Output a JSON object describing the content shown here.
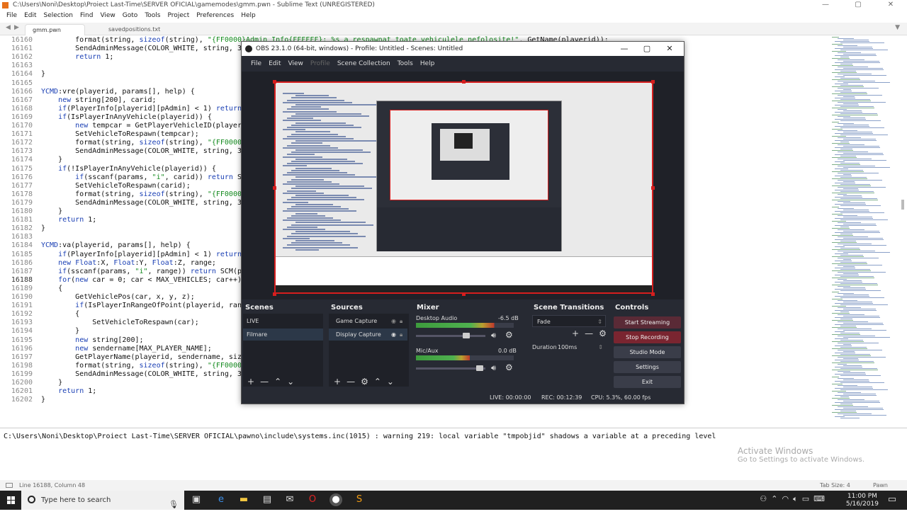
{
  "sublime": {
    "title": "C:\\Users\\Noni\\Desktop\\Proiect Last-Time\\SERVER OFICIAL\\gamemodes\\gmm.pwn - Sublime Text (UNREGISTERED)",
    "menu": [
      "File",
      "Edit",
      "Selection",
      "Find",
      "View",
      "Goto",
      "Tools",
      "Project",
      "Preferences",
      "Help"
    ],
    "tabs": [
      "gmm.pwn",
      "savedpositions.txt"
    ],
    "lines": [
      {
        "n": "16160",
        "t": "        format(string, sizeof(string), \"{FF0000}Admin Info{FFFFFF}: %s a respawnat toate vehiculele nefolosite!\", GetName(playerid));"
      },
      {
        "n": "16161",
        "t": "        SendAdminMessage(COLOR_WHITE, string, 3);"
      },
      {
        "n": "16162",
        "t": "        return 1;"
      },
      {
        "n": "16163",
        "t": "    "
      },
      {
        "n": "16164",
        "t": "}"
      },
      {
        "n": "16165",
        "t": ""
      },
      {
        "n": "16166",
        "t": "YCMD:vre(playerid, params[], help) {"
      },
      {
        "n": "16167",
        "t": "    new string[200], carid;"
      },
      {
        "n": "16168",
        "t": "    if(PlayerInfo[playerid][pAdmin] < 1) return"
      },
      {
        "n": "16169",
        "t": "    if(IsPlayerInAnyVehicle(playerid)) {"
      },
      {
        "n": "16170",
        "t": "        new tempcar = GetPlayerVehicleID(playeri"
      },
      {
        "n": "16171",
        "t": "        SetVehicleToRespawn(tempcar);"
      },
      {
        "n": "16172",
        "t": "        format(string, sizeof(string), \"{FF0000"
      },
      {
        "n": "16173",
        "t": "        SendAdminMessage(COLOR_WHITE, string, 3)"
      },
      {
        "n": "16174",
        "t": "    }"
      },
      {
        "n": "16175",
        "t": "    if(!IsPlayerInAnyVehicle(playerid)) {"
      },
      {
        "n": "16176",
        "t": "        if(sscanf(params, \"i\", carid)) return SC"
      },
      {
        "n": "16177",
        "t": "        SetVehicleToRespawn(carid);"
      },
      {
        "n": "16178",
        "t": "        format(string, sizeof(string), \"{FF0000"
      },
      {
        "n": "16179",
        "t": "        SendAdminMessage(COLOR_WHITE, string, 3)"
      },
      {
        "n": "16180",
        "t": "    }"
      },
      {
        "n": "16181",
        "t": "    return 1;"
      },
      {
        "n": "16182",
        "t": "}"
      },
      {
        "n": "16183",
        "t": ""
      },
      {
        "n": "16184",
        "t": "YCMD:va(playerid, params[], help) {"
      },
      {
        "n": "16185",
        "t": "    if(PlayerInfo[playerid][pAdmin] < 1) return"
      },
      {
        "n": "16186",
        "t": "    new Float:X, Float:Y, Float:Z, range;"
      },
      {
        "n": "16187",
        "t": "    if(sscanf(params, \"i\", range)) return SCM(pl"
      },
      {
        "n": "16188",
        "t": "    for(new car = 0; car < MAX_VEHICLES; car++)"
      },
      {
        "n": "16189",
        "t": "    {"
      },
      {
        "n": "16190",
        "t": "        GetVehiclePos(car, x, y, z);"
      },
      {
        "n": "16191",
        "t": "        if(IsPlayerInRangeOfPoint(playerid, rang"
      },
      {
        "n": "16192",
        "t": "        {"
      },
      {
        "n": "16193",
        "t": "            SetVehicleToRespawn(car);"
      },
      {
        "n": "16194",
        "t": "        }"
      },
      {
        "n": "16195",
        "t": "        new string[200];"
      },
      {
        "n": "16196",
        "t": "        new sendername[MAX_PLAYER_NAME];"
      },
      {
        "n": "16197",
        "t": "        GetPlayerName(playerid, sendername, size"
      },
      {
        "n": "16198",
        "t": "        format(string, sizeof(string), \"{FF0000"
      },
      {
        "n": "16199",
        "t": "        SendAdminMessage(COLOR_WHITE, string, 3)"
      },
      {
        "n": "16200",
        "t": "    }"
      },
      {
        "n": "16201",
        "t": "    return 1;"
      },
      {
        "n": "16202",
        "t": "}"
      }
    ],
    "console": "C:\\Users\\Noni\\Desktop\\Proiect Last-Time\\SERVER OFICIAL\\pawno\\include\\systems.inc(1015) : warning 219: local variable \"tmpobjid\" shadows a variable at a preceding level",
    "status_left": "Line 16188, Column 48",
    "status_tab": "Tab Size: 4",
    "status_syntax": "Pawn"
  },
  "activate": {
    "title": "Activate Windows",
    "sub": "Go to Settings to activate Windows."
  },
  "obs": {
    "title": "OBS 23.1.0 (64-bit, windows) - Profile: Untitled - Scenes: Untitled",
    "menu": [
      "File",
      "Edit",
      "View",
      "Profile",
      "Scene Collection",
      "Tools",
      "Help"
    ],
    "docks": {
      "scenes": "Scenes",
      "sources": "Sources",
      "mixer": "Mixer",
      "transitions": "Scene Transitions",
      "controls": "Controls"
    },
    "scenes": [
      "LIVE",
      "Filmare"
    ],
    "sources": [
      "Game Capture",
      "Display Capture"
    ],
    "mixer": [
      {
        "name": "Desktop Audio",
        "db": "-6.5 dB",
        "fill": 0.8,
        "vol": 0.75
      },
      {
        "name": "Mic/Aux",
        "db": "0.0 dB",
        "fill": 0.55,
        "vol": 0.97
      }
    ],
    "transition": "Fade",
    "duration_label": "Duration",
    "duration": "100ms",
    "controls": [
      "Start Streaming",
      "Stop Recording",
      "Studio Mode",
      "Settings",
      "Exit"
    ],
    "status": {
      "live": "LIVE: 00:00:00",
      "rec": "REC: 00:12:39",
      "cpu": "CPU: 5.3%, 60.00 fps"
    }
  },
  "taskbar": {
    "search_placeholder": "Type here to search",
    "time": "11:00 PM",
    "date": "5/16/2019"
  }
}
